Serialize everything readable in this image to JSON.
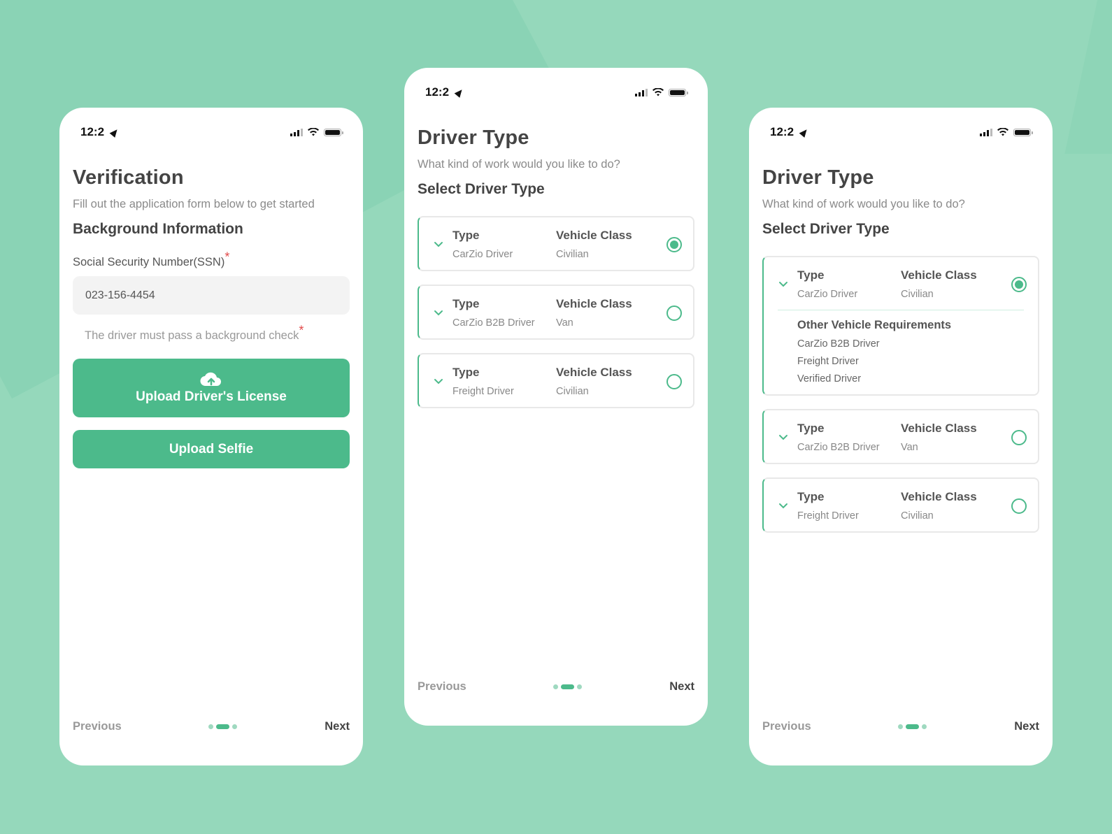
{
  "colors": {
    "accent": "#4cba8b",
    "background": "#95d8bb",
    "required": "#e24b4b"
  },
  "status_bar": {
    "time": "12:2",
    "icons": [
      "location-arrow-icon",
      "signal-icon",
      "wifi-icon",
      "battery-icon"
    ]
  },
  "screen1": {
    "title": "Verification",
    "subtitle": "Fill out the application form below to get started",
    "section": "Background Information",
    "ssn_label": "Social Security Number(SSN)",
    "required_mark": "*",
    "ssn_value": "023-156-4454",
    "note": "The driver must pass a background check",
    "upload_license": "Upload Driver's License",
    "upload_selfie": "Upload Selfie",
    "prev": "Previous",
    "next": "Next",
    "page_indicator": {
      "current": 2,
      "total": 3
    }
  },
  "screen2": {
    "title": "Driver Type",
    "subtitle": "What kind of work would you like to do?",
    "section": "Select Driver Type",
    "type_header": "Type",
    "class_header": "Vehicle Class",
    "options": [
      {
        "type": "CarZio Driver",
        "vehicle_class": "Civilian",
        "selected": true
      },
      {
        "type": "CarZio B2B Driver",
        "vehicle_class": "Van",
        "selected": false
      },
      {
        "type": "Freight Driver",
        "vehicle_class": "Civilian",
        "selected": false
      }
    ],
    "prev": "Previous",
    "next": "Next",
    "page_indicator": {
      "current": 2,
      "total": 3
    }
  },
  "screen3": {
    "title": "Driver Type",
    "subtitle": "What kind of work would you like to do?",
    "section": "Select Driver Type",
    "type_header": "Type",
    "class_header": "Vehicle Class",
    "options": [
      {
        "type": "CarZio Driver",
        "vehicle_class": "Civilian",
        "selected": true,
        "expanded": true
      },
      {
        "type": "CarZio B2B Driver",
        "vehicle_class": "Van",
        "selected": false
      },
      {
        "type": "Freight Driver",
        "vehicle_class": "Civilian",
        "selected": false
      }
    ],
    "requirements_title": "Other Vehicle Requirements",
    "requirements": [
      "CarZio B2B Driver",
      "Freight Driver",
      "Verified Driver"
    ],
    "prev": "Previous",
    "next": "Next",
    "page_indicator": {
      "current": 2,
      "total": 3
    }
  }
}
